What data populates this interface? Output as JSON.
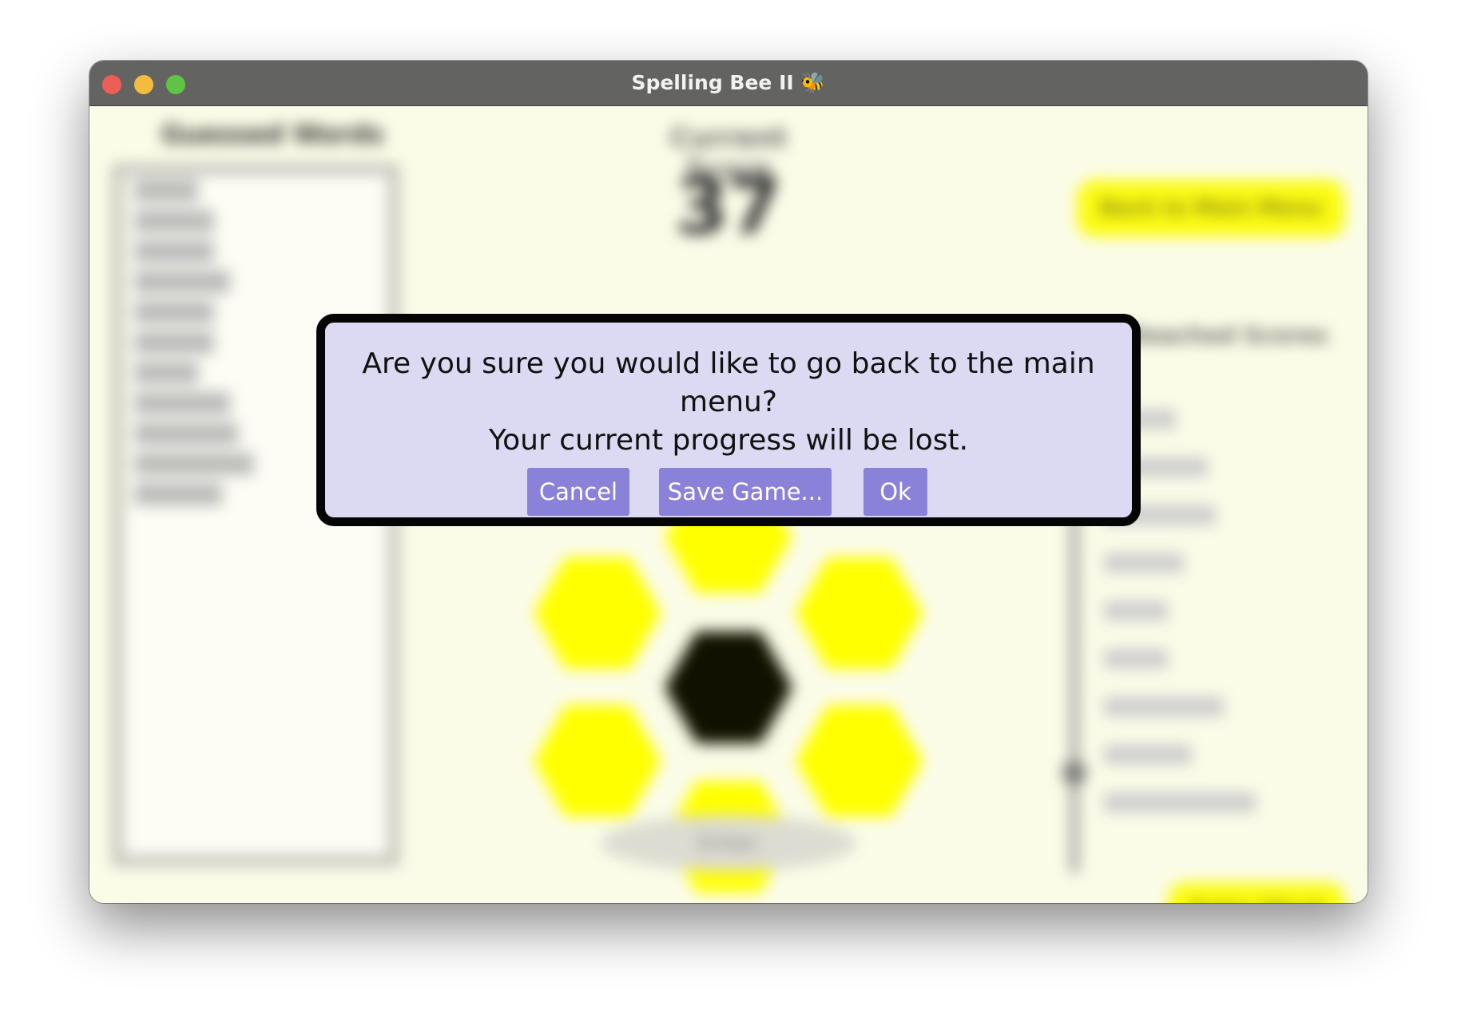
{
  "window": {
    "title": "Spelling Bee II 🐝"
  },
  "dialog": {
    "message_line1": "Are you sure you would like to go back to the main menu?",
    "message_line2": "Your current progress will be lost.",
    "cancel_label": "Cancel",
    "save_label": "Save Game...",
    "ok_label": "Ok"
  },
  "background": {
    "found_words_heading": "Guessed Words",
    "score_label": "Current Score",
    "score_value": "37",
    "back_button": "Back to Main Menu",
    "rank_heading": "Reached Scores",
    "entry_placeholder": "Enter",
    "submit_button": "Enter Word"
  },
  "colors": {
    "dialog_bg": "#dcdaf2",
    "dialog_button": "#8a81d8",
    "honeycomb_yellow": "#ffff00",
    "window_bg": "#fbfce8"
  }
}
